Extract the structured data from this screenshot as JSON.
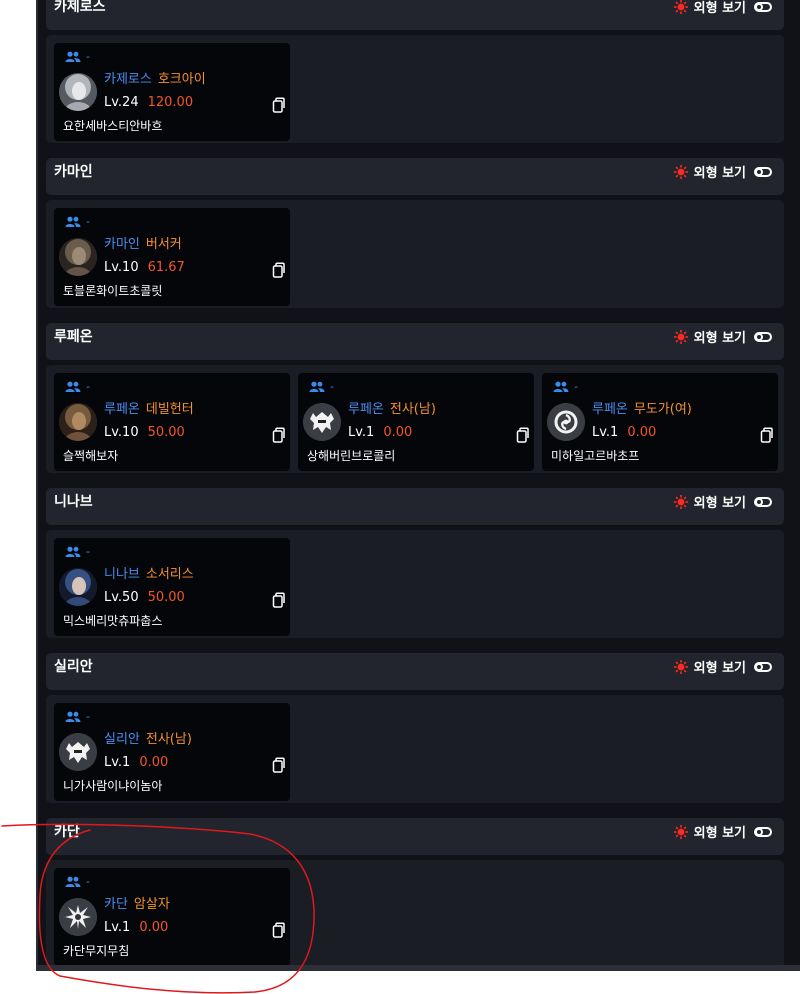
{
  "appearance_label": "외형 보기",
  "sections": [
    {
      "title": "카제로스",
      "cards": [
        {
          "party": "-",
          "server": "카제로스",
          "class": "호크아이",
          "level": "Lv.24",
          "item_level": "120.00",
          "name": "요한세바스티안바흐",
          "avatar": "photo-silver"
        }
      ]
    },
    {
      "title": "카마인",
      "cards": [
        {
          "party": "-",
          "server": "카마인",
          "class": "버서커",
          "level": "Lv.10",
          "item_level": "61.67",
          "name": "토블론화이트초콜릿",
          "avatar": "photo-dark"
        }
      ]
    },
    {
      "title": "루페온",
      "cards": [
        {
          "party": "-",
          "server": "루페온",
          "class": "데빌헌터",
          "level": "Lv.10",
          "item_level": "50.00",
          "name": "슬쩍해보자",
          "avatar": "photo-brown"
        },
        {
          "party": "-",
          "server": "루페온",
          "class": "전사(남)",
          "level": "Lv.1",
          "item_level": "0.00",
          "name": "상해버린브로콜리",
          "avatar": "warrior-emblem"
        },
        {
          "party": "-",
          "server": "루페온",
          "class": "무도가(여)",
          "level": "Lv.1",
          "item_level": "0.00",
          "name": "미하일고르바초프",
          "avatar": "martial-emblem"
        }
      ]
    },
    {
      "title": "니나브",
      "cards": [
        {
          "party": "-",
          "server": "니나브",
          "class": "소서리스",
          "level": "Lv.50",
          "item_level": "50.00",
          "name": "믹스베리맛츄파춥스",
          "avatar": "photo-blue"
        }
      ]
    },
    {
      "title": "실리안",
      "cards": [
        {
          "party": "-",
          "server": "실리안",
          "class": "전사(남)",
          "level": "Lv.1",
          "item_level": "0.00",
          "name": "니가사람이냐이놈아",
          "avatar": "warrior-emblem"
        }
      ]
    },
    {
      "title": "카단",
      "cards": [
        {
          "party": "-",
          "server": "카단",
          "class": "암살자",
          "level": "Lv.1",
          "item_level": "0.00",
          "name": "카단무지무침",
          "avatar": "assassin-emblem"
        }
      ]
    }
  ],
  "colors": {
    "server": "#4a8df0",
    "class": "#f4902f",
    "item_level": "#f2552a",
    "annotation": "#e0191c"
  }
}
